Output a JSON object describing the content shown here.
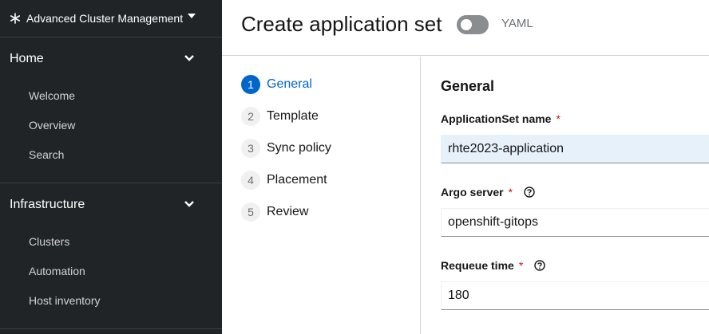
{
  "sidebar": {
    "perspective": "Advanced Cluster Management",
    "groups": [
      {
        "label": "Home",
        "items": [
          "Welcome",
          "Overview",
          "Search"
        ]
      },
      {
        "label": "Infrastructure",
        "items": [
          "Clusters",
          "Automation",
          "Host inventory"
        ]
      }
    ]
  },
  "header": {
    "title": "Create application set",
    "yaml_label": "YAML",
    "yaml_enabled": false
  },
  "wizard": {
    "steps": [
      {
        "num": "1",
        "label": "General",
        "active": true
      },
      {
        "num": "2",
        "label": "Template",
        "active": false
      },
      {
        "num": "3",
        "label": "Sync policy",
        "active": false
      },
      {
        "num": "4",
        "label": "Placement",
        "active": false
      },
      {
        "num": "5",
        "label": "Review",
        "active": false
      }
    ]
  },
  "form": {
    "section_title": "General",
    "required_mark": "*",
    "fields": [
      {
        "label": "ApplicationSet name",
        "value": "rhte2023-application",
        "help": false
      },
      {
        "label": "Argo server",
        "value": "openshift-gitops",
        "help": true
      },
      {
        "label": "Requeue time",
        "value": "180",
        "help": true
      }
    ]
  },
  "colors": {
    "sidebar_bg": "#212427",
    "accent": "#0066cc",
    "required": "#c9190b",
    "focused_input_bg": "#e7f1fa"
  }
}
